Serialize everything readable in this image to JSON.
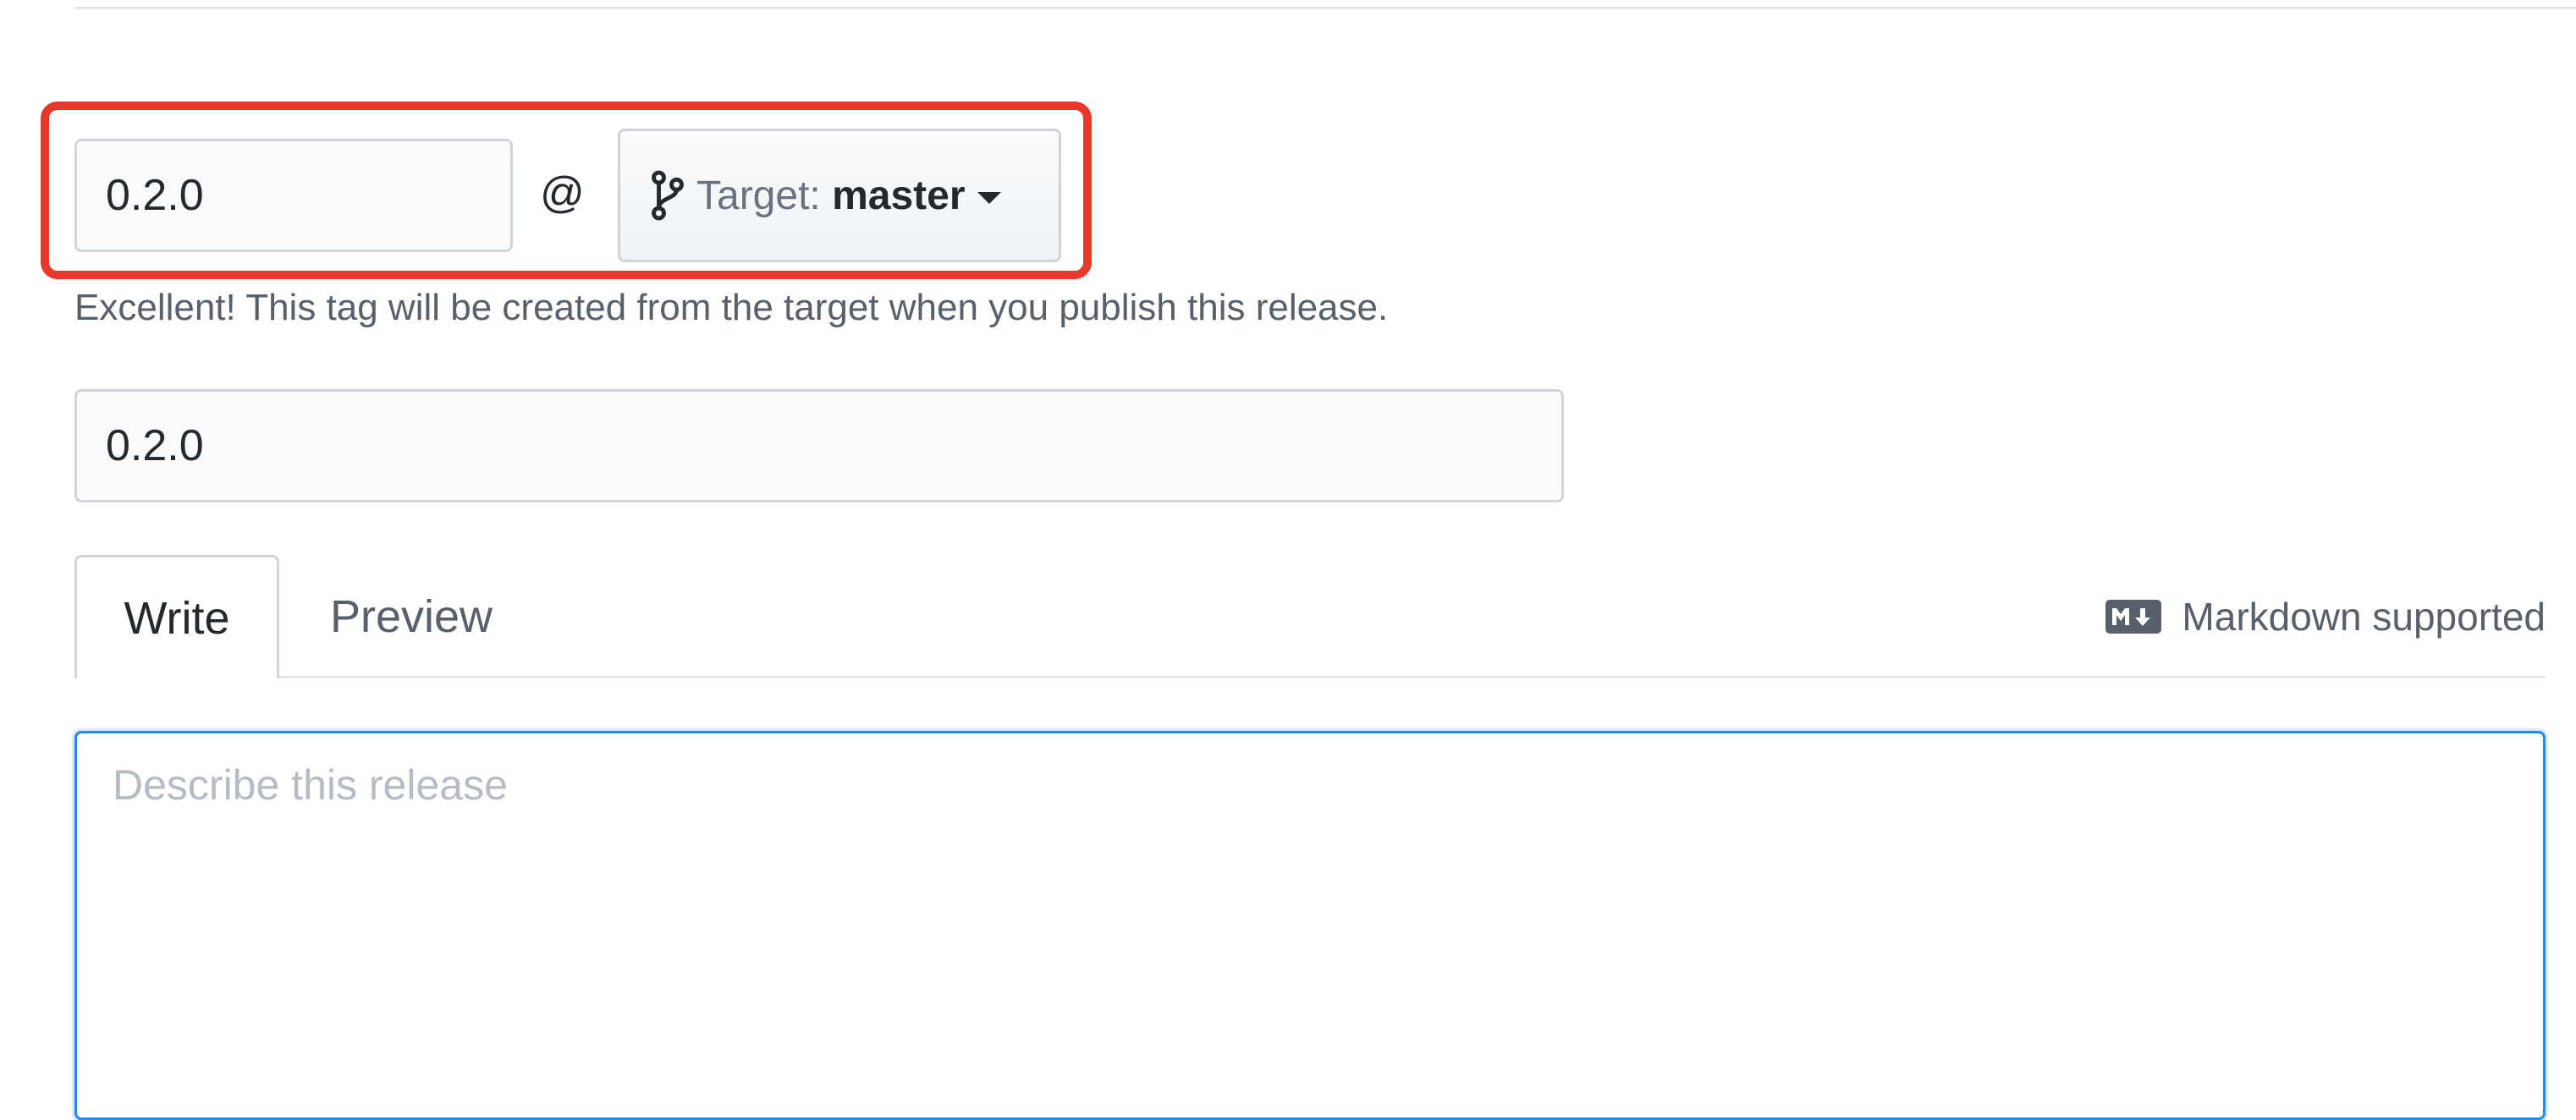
{
  "release_form": {
    "tag": {
      "value": "0.2.0",
      "separator": "@"
    },
    "target": {
      "prefix": "Target: ",
      "branch": "master"
    },
    "hint": "Excellent! This tag will be created from the target when you publish this release.",
    "title": {
      "value": "0.2.0"
    },
    "editor": {
      "tabs": [
        {
          "label": "Write",
          "active": true
        },
        {
          "label": "Preview",
          "active": false
        }
      ],
      "markdown_note": "Markdown supported",
      "body_placeholder": "Describe this release",
      "body_value": ""
    }
  },
  "annotation": {
    "highlight_color": "#e8382c"
  },
  "icons": {
    "branch": "git-branch-icon",
    "dropdown": "caret-down-icon",
    "markdown": "markdown-icon"
  },
  "colors": {
    "focus_border": "#2188ff",
    "muted_text": "#586069",
    "input_background": "#fafbfc"
  }
}
